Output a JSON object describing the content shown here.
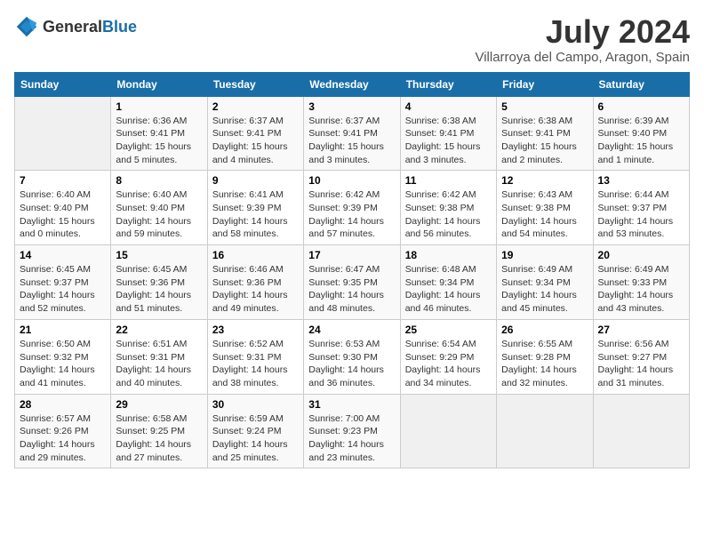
{
  "header": {
    "logo_general": "General",
    "logo_blue": "Blue",
    "month_title": "July 2024",
    "location": "Villarroya del Campo, Aragon, Spain"
  },
  "days_of_week": [
    "Sunday",
    "Monday",
    "Tuesday",
    "Wednesday",
    "Thursday",
    "Friday",
    "Saturday"
  ],
  "weeks": [
    [
      {
        "day": "",
        "content": ""
      },
      {
        "day": "1",
        "content": "Sunrise: 6:36 AM\nSunset: 9:41 PM\nDaylight: 15 hours\nand 5 minutes."
      },
      {
        "day": "2",
        "content": "Sunrise: 6:37 AM\nSunset: 9:41 PM\nDaylight: 15 hours\nand 4 minutes."
      },
      {
        "day": "3",
        "content": "Sunrise: 6:37 AM\nSunset: 9:41 PM\nDaylight: 15 hours\nand 3 minutes."
      },
      {
        "day": "4",
        "content": "Sunrise: 6:38 AM\nSunset: 9:41 PM\nDaylight: 15 hours\nand 3 minutes."
      },
      {
        "day": "5",
        "content": "Sunrise: 6:38 AM\nSunset: 9:41 PM\nDaylight: 15 hours\nand 2 minutes."
      },
      {
        "day": "6",
        "content": "Sunrise: 6:39 AM\nSunset: 9:40 PM\nDaylight: 15 hours\nand 1 minute."
      }
    ],
    [
      {
        "day": "7",
        "content": "Sunrise: 6:40 AM\nSunset: 9:40 PM\nDaylight: 15 hours\nand 0 minutes."
      },
      {
        "day": "8",
        "content": "Sunrise: 6:40 AM\nSunset: 9:40 PM\nDaylight: 14 hours\nand 59 minutes."
      },
      {
        "day": "9",
        "content": "Sunrise: 6:41 AM\nSunset: 9:39 PM\nDaylight: 14 hours\nand 58 minutes."
      },
      {
        "day": "10",
        "content": "Sunrise: 6:42 AM\nSunset: 9:39 PM\nDaylight: 14 hours\nand 57 minutes."
      },
      {
        "day": "11",
        "content": "Sunrise: 6:42 AM\nSunset: 9:38 PM\nDaylight: 14 hours\nand 56 minutes."
      },
      {
        "day": "12",
        "content": "Sunrise: 6:43 AM\nSunset: 9:38 PM\nDaylight: 14 hours\nand 54 minutes."
      },
      {
        "day": "13",
        "content": "Sunrise: 6:44 AM\nSunset: 9:37 PM\nDaylight: 14 hours\nand 53 minutes."
      }
    ],
    [
      {
        "day": "14",
        "content": "Sunrise: 6:45 AM\nSunset: 9:37 PM\nDaylight: 14 hours\nand 52 minutes."
      },
      {
        "day": "15",
        "content": "Sunrise: 6:45 AM\nSunset: 9:36 PM\nDaylight: 14 hours\nand 51 minutes."
      },
      {
        "day": "16",
        "content": "Sunrise: 6:46 AM\nSunset: 9:36 PM\nDaylight: 14 hours\nand 49 minutes."
      },
      {
        "day": "17",
        "content": "Sunrise: 6:47 AM\nSunset: 9:35 PM\nDaylight: 14 hours\nand 48 minutes."
      },
      {
        "day": "18",
        "content": "Sunrise: 6:48 AM\nSunset: 9:34 PM\nDaylight: 14 hours\nand 46 minutes."
      },
      {
        "day": "19",
        "content": "Sunrise: 6:49 AM\nSunset: 9:34 PM\nDaylight: 14 hours\nand 45 minutes."
      },
      {
        "day": "20",
        "content": "Sunrise: 6:49 AM\nSunset: 9:33 PM\nDaylight: 14 hours\nand 43 minutes."
      }
    ],
    [
      {
        "day": "21",
        "content": "Sunrise: 6:50 AM\nSunset: 9:32 PM\nDaylight: 14 hours\nand 41 minutes."
      },
      {
        "day": "22",
        "content": "Sunrise: 6:51 AM\nSunset: 9:31 PM\nDaylight: 14 hours\nand 40 minutes."
      },
      {
        "day": "23",
        "content": "Sunrise: 6:52 AM\nSunset: 9:31 PM\nDaylight: 14 hours\nand 38 minutes."
      },
      {
        "day": "24",
        "content": "Sunrise: 6:53 AM\nSunset: 9:30 PM\nDaylight: 14 hours\nand 36 minutes."
      },
      {
        "day": "25",
        "content": "Sunrise: 6:54 AM\nSunset: 9:29 PM\nDaylight: 14 hours\nand 34 minutes."
      },
      {
        "day": "26",
        "content": "Sunrise: 6:55 AM\nSunset: 9:28 PM\nDaylight: 14 hours\nand 32 minutes."
      },
      {
        "day": "27",
        "content": "Sunrise: 6:56 AM\nSunset: 9:27 PM\nDaylight: 14 hours\nand 31 minutes."
      }
    ],
    [
      {
        "day": "28",
        "content": "Sunrise: 6:57 AM\nSunset: 9:26 PM\nDaylight: 14 hours\nand 29 minutes."
      },
      {
        "day": "29",
        "content": "Sunrise: 6:58 AM\nSunset: 9:25 PM\nDaylight: 14 hours\nand 27 minutes."
      },
      {
        "day": "30",
        "content": "Sunrise: 6:59 AM\nSunset: 9:24 PM\nDaylight: 14 hours\nand 25 minutes."
      },
      {
        "day": "31",
        "content": "Sunrise: 7:00 AM\nSunset: 9:23 PM\nDaylight: 14 hours\nand 23 minutes."
      },
      {
        "day": "",
        "content": ""
      },
      {
        "day": "",
        "content": ""
      },
      {
        "day": "",
        "content": ""
      }
    ]
  ]
}
